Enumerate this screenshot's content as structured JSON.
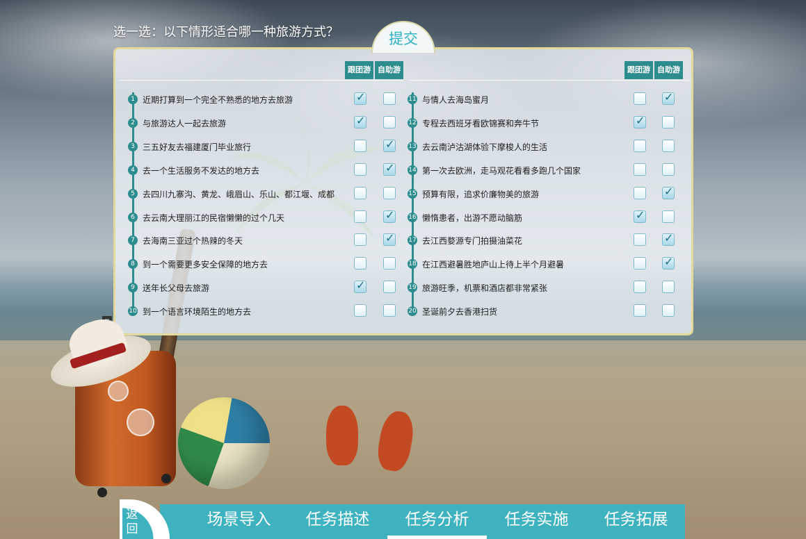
{
  "question": "选一选：以下情形适合哪一种旅游方式？",
  "submit_label": "提交",
  "headers": {
    "group": "跟团游",
    "self": "自助游"
  },
  "left_items": [
    {
      "num": "1",
      "text": "近期打算到一个完全不熟悉的地方去旅游",
      "group": true,
      "self": false
    },
    {
      "num": "2",
      "text": "与旅游达人一起去旅游",
      "group": true,
      "self": false
    },
    {
      "num": "3",
      "text": "三五好友去福建厦门毕业旅行",
      "group": false,
      "self": true
    },
    {
      "num": "4",
      "text": "去一个生活服务不发达的地方去",
      "group": false,
      "self": true
    },
    {
      "num": "5",
      "text": "去四川九寨沟、黄龙、峨眉山、乐山、都江堰、成都",
      "group": false,
      "self": false
    },
    {
      "num": "6",
      "text": "去云南大理丽江的民宿懒懒的过个几天",
      "group": false,
      "self": true
    },
    {
      "num": "7",
      "text": "去海南三亚过个热辣的冬天",
      "group": false,
      "self": true
    },
    {
      "num": "8",
      "text": "到一个需要更多安全保障的地方去",
      "group": false,
      "self": false
    },
    {
      "num": "9",
      "text": "送年长父母去旅游",
      "group": true,
      "self": false
    },
    {
      "num": "10",
      "text": "到一个语言环境陌生的地方去",
      "group": false,
      "self": false
    }
  ],
  "right_items": [
    {
      "num": "11",
      "text": "与情人去海岛蜜月",
      "group": false,
      "self": true
    },
    {
      "num": "12",
      "text": "专程去西班牙看欧锦赛和奔牛节",
      "group": true,
      "self": false
    },
    {
      "num": "13",
      "text": "去云南泸沽湖体验下摩梭人的生活",
      "group": false,
      "self": false
    },
    {
      "num": "14",
      "text": "第一次去欧洲，走马观花看看多跑几个国家",
      "group": false,
      "self": false
    },
    {
      "num": "15",
      "text": "预算有限，追求价廉物美的旅游",
      "group": false,
      "self": true
    },
    {
      "num": "16",
      "text": "懒惰患者，出游不愿动脑筋",
      "group": true,
      "self": false
    },
    {
      "num": "17",
      "text": "去江西婺源专门拍摄油菜花",
      "group": false,
      "self": true
    },
    {
      "num": "18",
      "text": "在江西避暑胜地庐山上待上半个月避暑",
      "group": false,
      "self": true
    },
    {
      "num": "19",
      "text": "旅游旺季，机票和酒店都非常紧张",
      "group": false,
      "self": false
    },
    {
      "num": "20",
      "text": "圣诞前夕去香港扫货",
      "group": false,
      "self": false
    }
  ],
  "back_label": "返回",
  "nav": [
    "场景导入",
    "任务描述",
    "任务分析",
    "任务实施",
    "任务拓展"
  ],
  "nav_active": "任务分析",
  "colors": {
    "accent": "#2c8c8e",
    "nav": "#3fb2bf",
    "panel_border": "#e3d99a"
  }
}
